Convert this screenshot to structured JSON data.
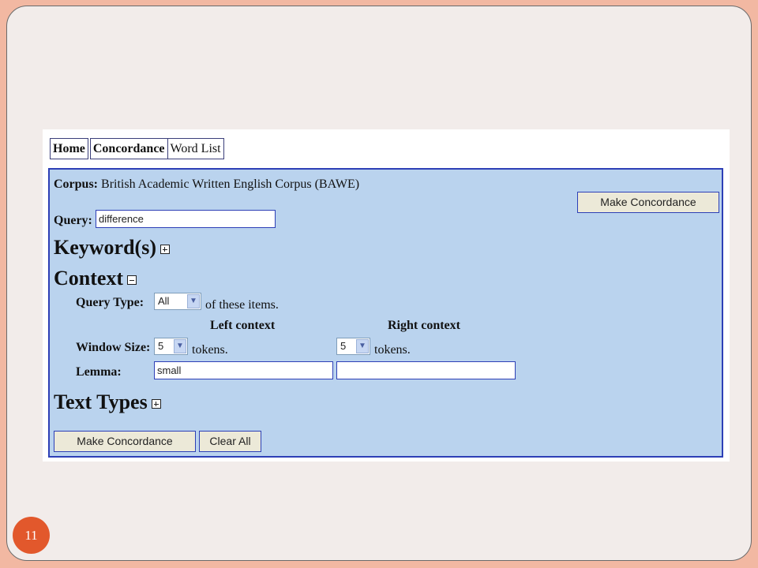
{
  "nav": {
    "tabs": [
      "Home",
      "Concordance",
      "Word List"
    ]
  },
  "corpus": {
    "label": "Corpus:",
    "value": "British Academic Written English Corpus (BAWE)"
  },
  "query": {
    "label": "Query:",
    "value": "difference"
  },
  "buttons": {
    "make_concordance": "Make Concordance",
    "clear_all": "Clear All"
  },
  "sections": {
    "keywords": "Keyword(s)",
    "context": "Context",
    "text_types": "Text Types"
  },
  "context": {
    "query_type_label": "Query Type:",
    "query_type_value": "All",
    "query_type_suffix": "of these items.",
    "left_header": "Left context",
    "right_header": "Right context",
    "window_size_label": "Window Size:",
    "left_window": "5",
    "right_window": "5",
    "tokens_label": "tokens.",
    "lemma_label": "Lemma:",
    "left_lemma": "small",
    "right_lemma": ""
  },
  "slide": {
    "number": "11"
  },
  "icons": {
    "keywords_toggle": "plus-box-icon",
    "context_toggle": "minus-box-icon",
    "text_types_toggle": "plus-box-icon",
    "select_arrow": "chevron-down-icon"
  },
  "colors": {
    "background": "#F2B8A2",
    "slide": "#F2ECEA",
    "panel": "#BAD3EE",
    "panel_border": "#2D3FB6",
    "badge": "#E2582C"
  }
}
